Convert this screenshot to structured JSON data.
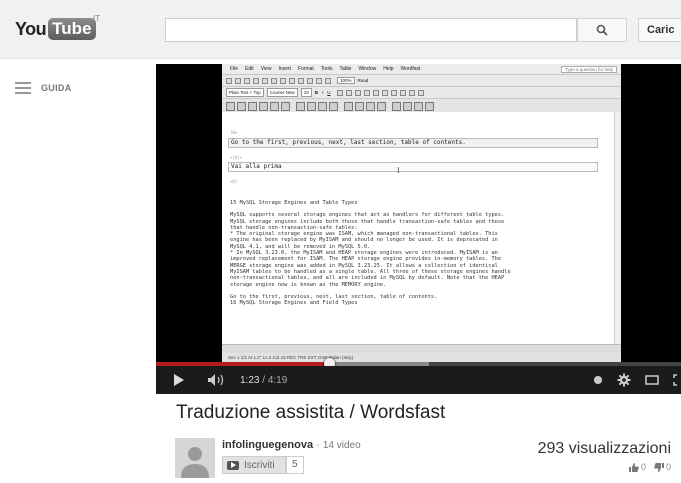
{
  "header": {
    "logo_you": "You",
    "logo_tube": "Tube",
    "country": "IT",
    "search_placeholder": "",
    "upload_label": "Caric"
  },
  "guide": {
    "label": "GUIDA"
  },
  "player": {
    "app": {
      "menu": [
        "File",
        "Edit",
        "View",
        "Insert",
        "Format",
        "Tools",
        "Table",
        "Window",
        "Help",
        "Wordfast"
      ],
      "help_box": "Type a question for help",
      "zoom": "100%",
      "style": "Plain Text + Top",
      "font": "Courier New",
      "size": "10",
      "read_label": "Read"
    },
    "doc": {
      "src_tag": "{0>",
      "tgt_tag": "<}0{>",
      "end_tag": "<0}",
      "source_segment": "Go to the first, previous, next, last section, table of contents.",
      "target_segment": "Vai alla prima",
      "paragraphs": [
        "15 MySQL Storage Engines and Table Types",
        "MySQL supports several storage engines that act as handlers for different table types.\nMySQL storage engines include both those that handle transaction-safe tables and those\nthat handle non-transaction-safe tables:\n* The original storage engine was ISAM, which managed non-transactional tables. This\nengine has been replaced by MyISAM and should no longer be used. It is deprecated in\nMySQL 4.1, and will be removed in MySQL 5.0.\n* In MySQL 3.23.0, the MyISAM and HEAP storage engines were introduced. MyISAM is an\nimproved replacement for ISAM. The HEAP storage engine provides in-memory tables. The\nMERGE storage engine was added in MySQL 3.23.25. It allows a collection of identical\nMyISAM tables to be handled as a single table. All three of these storage engines handle\nnon-transactional tables, and all are included in MySQL by default. Note that the HEAP\nstorage engine now is known as the MEMORY engine.",
        "Go to the first, previous, next, last section, table of contents.\n16 MySQL Storage Engines and Field Types"
      ],
      "status": "Sec 1    1/1    At 1.2\"   Ln 2   Col 15   REC TRK EXT OVR   Italian (Italy)"
    },
    "progress_fraction": 0.33,
    "loaded_fraction": 0.52,
    "time_current": "1:23",
    "time_separator": " / ",
    "time_duration": "4:19"
  },
  "video": {
    "title": "Traduzione assistita / Wordsfast",
    "channel_name": "infolinguegenova",
    "separator": " · ",
    "video_count": "14 video",
    "subscribe_label": "Iscriviti",
    "subscriber_count": "5",
    "views": "293 visualizzazioni",
    "likes": "0",
    "dislikes": "0"
  },
  "colors": {
    "progress_played": "#b41d1d",
    "masthead_bg": "#f1f1f1"
  }
}
